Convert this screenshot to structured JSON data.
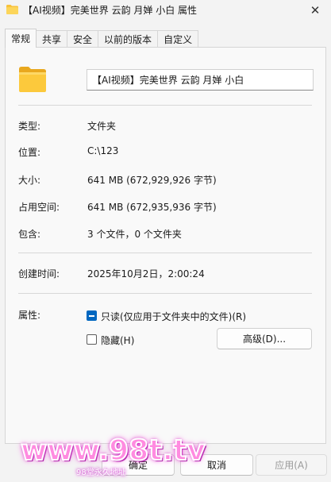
{
  "window": {
    "title": "【AI视频】完美世界 云韵 月婵 小白 属性",
    "close_glyph": "✕"
  },
  "tabs": [
    {
      "label": "常规",
      "active": true
    },
    {
      "label": "共享",
      "active": false
    },
    {
      "label": "安全",
      "active": false
    },
    {
      "label": "以前的版本",
      "active": false
    },
    {
      "label": "自定义",
      "active": false
    }
  ],
  "general": {
    "folder_name": "【AI视频】完美世界 云韵 月婵 小白",
    "type_label": "类型:",
    "type_value": "文件夹",
    "location_label": "位置:",
    "location_value": "C:\\123",
    "size_label": "大小:",
    "size_value": "641 MB (672,929,926 字节)",
    "disk_label": "占用空间:",
    "disk_value": "641 MB (672,935,936 字节)",
    "contains_label": "包含:",
    "contains_value": "3 个文件，0 个文件夹",
    "created_label": "创建时间:",
    "created_value": "2025年10月2日，2:00:24",
    "attributes_label": "属性:",
    "readonly_label": "只读(仅应用于文件夹中的文件)(R)",
    "readonly_state": "indeterminate",
    "hidden_label": "隐藏(H)",
    "hidden_checked": false,
    "advanced_button": "高级(D)..."
  },
  "footer": {
    "ok_label": "确定",
    "cancel_label": "取消",
    "apply_label": "应用(A)"
  },
  "watermark": {
    "main": "www.98t.tv",
    "sub": "98堂永久地址"
  },
  "colors": {
    "accent": "#0067c0",
    "folder": "#f8c23a",
    "watermark": "#ff8be0"
  }
}
